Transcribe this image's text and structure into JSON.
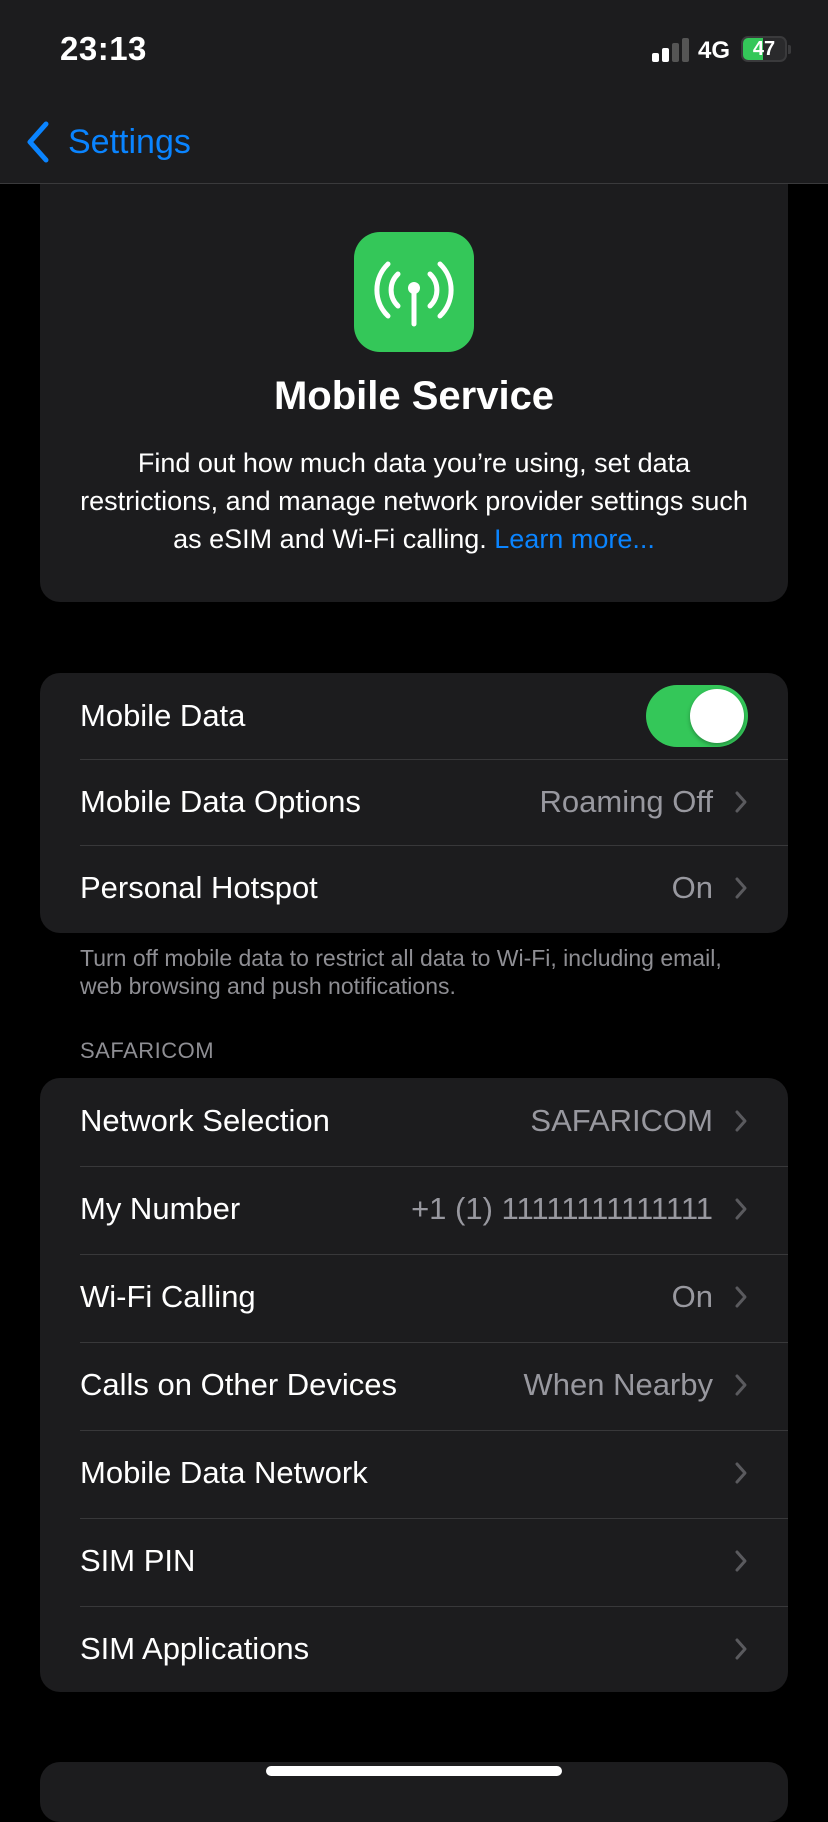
{
  "status_bar": {
    "time": "23:13",
    "network": "4G",
    "battery_percent": "47",
    "battery_level": 0.47,
    "signal_bars_active": 2,
    "signal_bars_total": 4
  },
  "nav": {
    "back_label": "Settings"
  },
  "intro": {
    "icon": "antenna-icon",
    "title": "Mobile Service",
    "description": "Find out how much data you’re using, set data restrictions, and manage network provider settings such as eSIM and Wi-Fi calling.",
    "link": "Learn more..."
  },
  "group1": {
    "rows": [
      {
        "label": "Mobile Data",
        "toggle": true
      },
      {
        "label": "Mobile Data Options",
        "value": "Roaming Off"
      },
      {
        "label": "Personal Hotspot",
        "value": "On"
      }
    ],
    "footnote": "Turn off mobile data to restrict all data to Wi-Fi, including email, web browsing and push notifications."
  },
  "group2": {
    "header": "SAFARICOM",
    "rows": [
      {
        "label": "Network Selection",
        "value": "SAFARICOM"
      },
      {
        "label": "My Number",
        "value": "+1 (1) 11111111111111"
      },
      {
        "label": "Wi-Fi Calling",
        "value": "On"
      },
      {
        "label": "Calls on Other Devices",
        "value": "When Nearby"
      },
      {
        "label": "Mobile Data Network",
        "value": ""
      },
      {
        "label": "SIM PIN",
        "value": ""
      },
      {
        "label": "SIM Applications",
        "value": ""
      }
    ]
  },
  "colors": {
    "accent": "#0a84ff",
    "green": "#34c759",
    "cell_bg": "#1c1c1e",
    "secondary_text": "#98989f"
  }
}
